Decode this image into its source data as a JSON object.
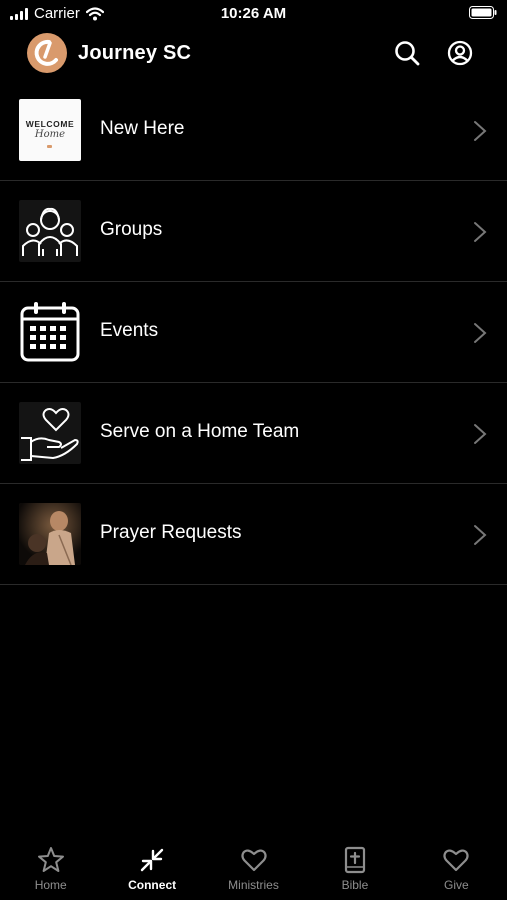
{
  "status_bar": {
    "carrier": "Carrier",
    "time": "10:26 AM"
  },
  "header": {
    "title": "Journey SC"
  },
  "menu": [
    {
      "label": "New Here",
      "thumb_text_1": "WELCOME",
      "thumb_text_2": "Home"
    },
    {
      "label": "Groups"
    },
    {
      "label": "Events"
    },
    {
      "label": "Serve on a Home Team"
    },
    {
      "label": "Prayer Requests"
    }
  ],
  "tabs": [
    {
      "label": "Home",
      "icon": "star-icon",
      "active": false
    },
    {
      "label": "Connect",
      "icon": "connect-arrows-icon",
      "active": true
    },
    {
      "label": "Ministries",
      "icon": "heart-icon",
      "active": false
    },
    {
      "label": "Bible",
      "icon": "bible-icon",
      "active": false
    },
    {
      "label": "Give",
      "icon": "heart-icon",
      "active": false
    }
  ],
  "colors": {
    "background": "#000000",
    "logo": "#d99a6c",
    "divider": "#2a2a2a",
    "inactive_tab": "#8e8e8e"
  }
}
